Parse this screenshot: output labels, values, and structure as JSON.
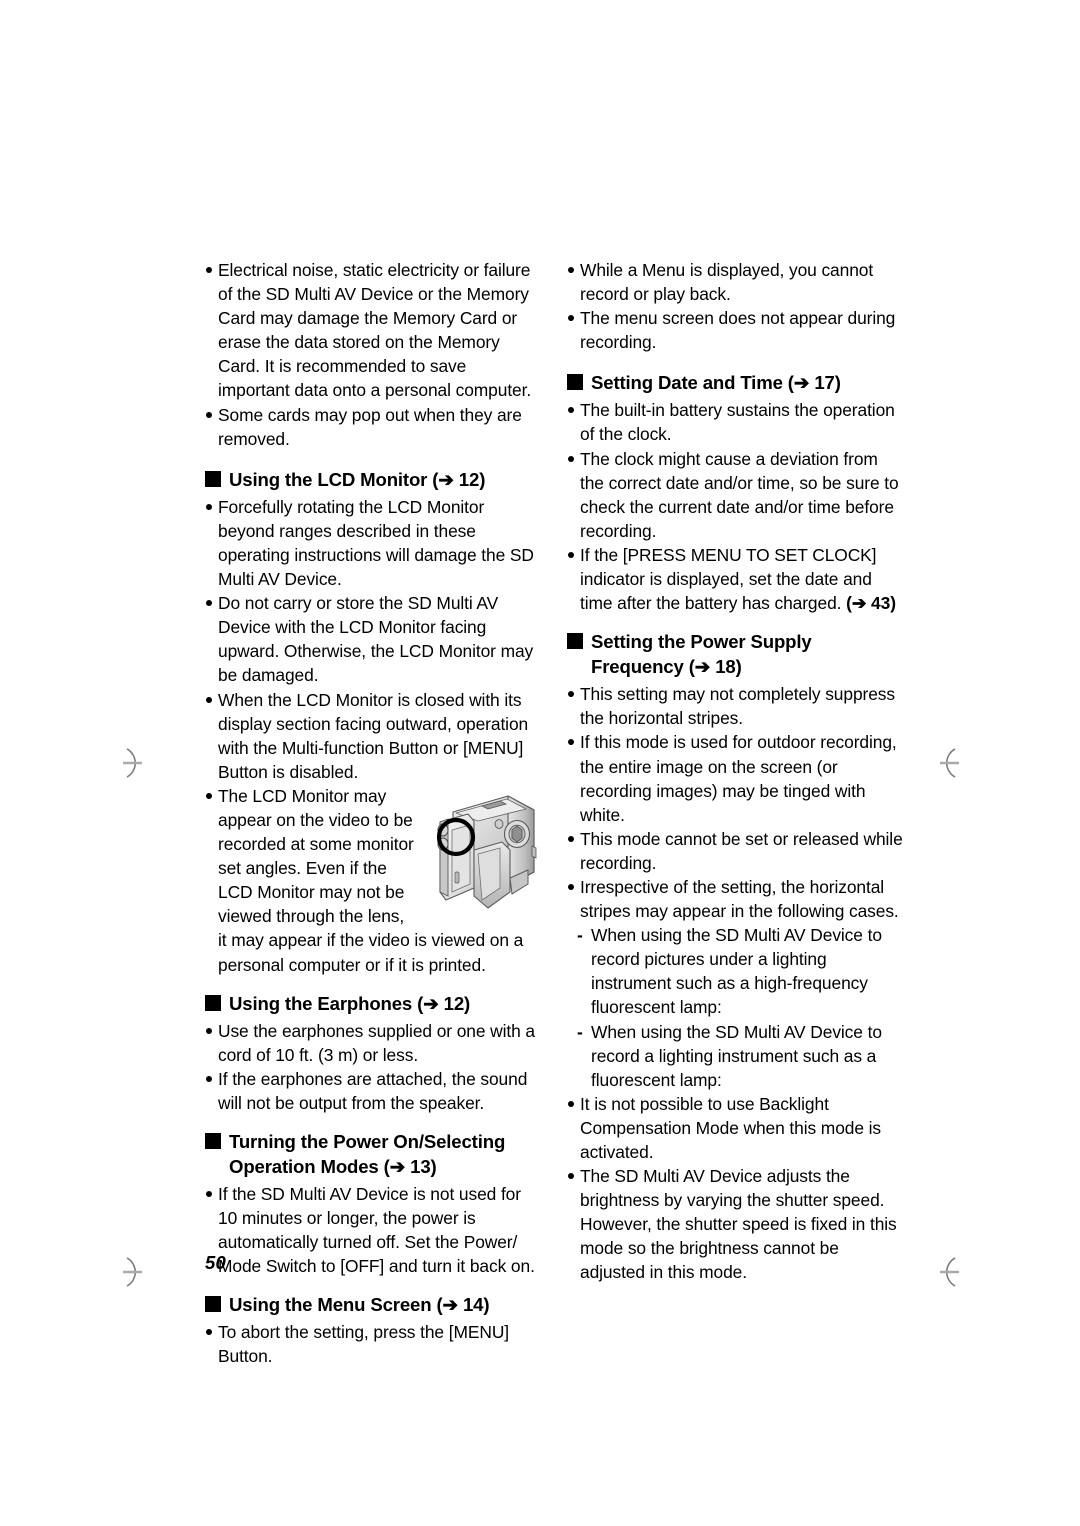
{
  "page": {
    "folio": "50",
    "arrow_glyph": "➔",
    "square_bullet": "■",
    "dash_bullet": "-"
  },
  "figure": {
    "name": "sd-multi-av-device-camcorder-illustration",
    "caption": "",
    "highlight": "circle-highlight-on-lcd-monitor-hinge"
  },
  "left_column": {
    "items": [
      {
        "type": "bullet",
        "text": "Electrical noise, static electricity or failure of the SD Multi AV Device or the Memory Card may damage the Memory Card or erase the data stored on the Memory Card. It is recommended to save important data onto a personal computer."
      },
      {
        "type": "bullet",
        "text": "Some cards may pop out when they are removed."
      },
      {
        "type": "heading",
        "text": "Using the LCD Monitor (",
        "ref": "12",
        "text_after": ")"
      },
      {
        "type": "bullet",
        "text": "Forcefully rotating the LCD Monitor beyond ranges described in these operating instructions will damage the SD Multi AV Device."
      },
      {
        "type": "bullet",
        "text": "Do not carry or store the SD Multi AV Device with the LCD Monitor facing upward. Otherwise, the LCD Monitor may be damaged."
      },
      {
        "type": "bullet",
        "text": "When the LCD Monitor is closed with its display section facing outward, operation with the Multi-function Button or [MENU] Button is disabled."
      },
      {
        "type": "bullet-figure",
        "text": "The LCD Monitor may appear on the video to be recorded at some monitor set angles. Even if the LCD Monitor may not be viewed through the lens, it may appear if the video is viewed on a personal computer or if it is printed."
      },
      {
        "type": "heading",
        "text": "Using the Earphones (",
        "ref": "12",
        "text_after": ")"
      },
      {
        "type": "bullet",
        "text": "Use the earphones supplied or one with a cord of 10 ft. (3 m) or less."
      },
      {
        "type": "bullet",
        "text": "If the earphones are attached, the sound will not be output from the speaker."
      },
      {
        "type": "heading",
        "text": "Turning the Power On/Selecting Operation Modes (",
        "ref": "13",
        "text_after": ")"
      },
      {
        "type": "bullet",
        "text": "If the SD Multi AV Device is not used for 10 minutes or longer, the power is automatically turned off. Set the Power/ Mode Switch to [OFF] and turn it back on."
      },
      {
        "type": "heading",
        "text": "Using the Menu Screen (",
        "ref": "14",
        "text_after": ")"
      },
      {
        "type": "bullet",
        "text": "To abort the setting, press the [MENU] Button."
      }
    ]
  },
  "right_column": {
    "items": [
      {
        "type": "bullet",
        "text": "While a Menu is displayed, you cannot record or play back."
      },
      {
        "type": "bullet",
        "text": "The menu screen does not appear during recording."
      },
      {
        "type": "heading",
        "text": "Setting Date and Time (",
        "ref": "17",
        "text_after": ")"
      },
      {
        "type": "bullet",
        "text": "The built-in battery sustains the operation of the clock."
      },
      {
        "type": "bullet",
        "text": "The clock might cause a deviation from the correct date and/or time, so be sure to check the current date and/or time before recording."
      },
      {
        "type": "bullet-ref",
        "text": "If the [PRESS MENU TO SET CLOCK] indicator is displayed, set the date and time after the battery has charged. ",
        "ref": "43"
      },
      {
        "type": "heading",
        "text": "Setting the Power Supply Frequency (",
        "ref": "18",
        "text_after": ")"
      },
      {
        "type": "bullet",
        "text": "This setting may not completely suppress the horizontal stripes."
      },
      {
        "type": "bullet",
        "text": "If this mode is used for outdoor recording, the entire image on the screen (or recording images) may be tinged with white."
      },
      {
        "type": "bullet",
        "text": "This mode cannot be set or released while recording."
      },
      {
        "type": "bullet",
        "text": "Irrespective of the setting, the horizontal stripes may appear in the following cases."
      },
      {
        "type": "subbullet",
        "text": "When using the SD Multi AV Device to record pictures under a lighting instrument such as a high-frequency fluorescent lamp:"
      },
      {
        "type": "subbullet",
        "text": "When using the SD Multi AV Device to record a lighting instrument such as a fluorescent lamp:"
      },
      {
        "type": "bullet",
        "text": "It is not possible to use Backlight Compensation Mode when this mode is activated."
      },
      {
        "type": "bullet",
        "text": "The SD Multi AV Device adjusts the brightness by varying the shutter speed. However, the shutter speed is fixed in this mode so the brightness cannot be adjusted in this mode."
      }
    ]
  }
}
